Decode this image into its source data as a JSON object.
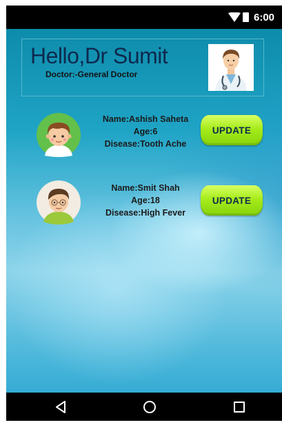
{
  "status_bar": {
    "time": "6:00"
  },
  "header": {
    "greeting": "Hello,Dr Sumit",
    "specialty": "Doctor:-General Doctor",
    "photo_icon": "doctor-with-stethoscope-icon"
  },
  "patients": [
    {
      "name": "Name:Ashish Saheta",
      "age": "Age:6",
      "disease": "Disease:Tooth Ache",
      "avatar_icon": "boy-avatar-icon",
      "button": "UPDATE"
    },
    {
      "name": "Name:Smit Shah",
      "age": "Age:18",
      "disease": "Disease:High Fever",
      "avatar_icon": "young-man-avatar-icon",
      "button": "UPDATE"
    }
  ],
  "nav": {
    "back": "back-icon",
    "home": "home-icon",
    "recents": "recents-icon"
  },
  "colors": {
    "button": "#a6ec1c",
    "title": "#0d2a4e",
    "background": "#1fa4c6"
  }
}
